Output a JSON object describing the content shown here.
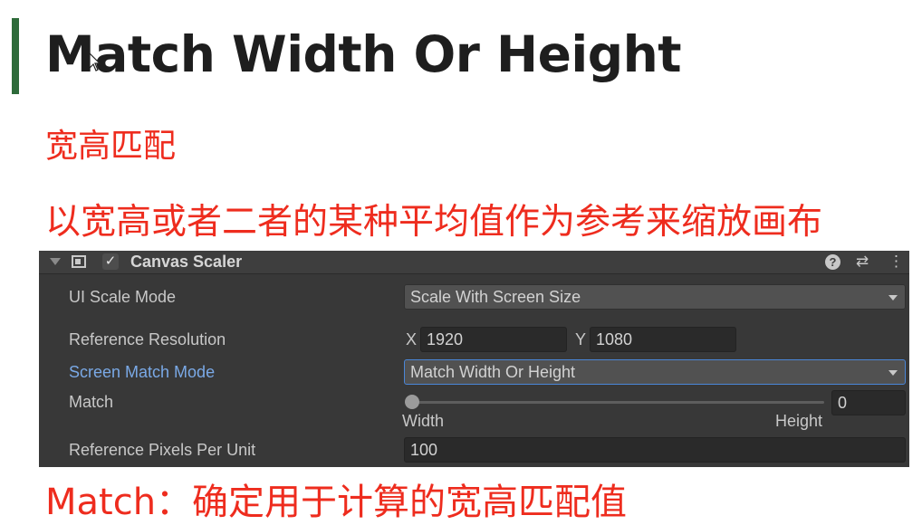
{
  "slide": {
    "title": "Match Width Or Height",
    "subtitle": "宽高匹配",
    "description": "以宽高或者二者的某种平均值作为参考来缩放画布",
    "note": "Match：确定用于计算的宽高匹配值"
  },
  "colors": {
    "accent": "#2e6b3a",
    "highlight_text": "#ee2c1e",
    "active_label": "#7aa9e6"
  },
  "inspector": {
    "component_title": "Canvas Scaler",
    "icons": [
      "foldout-arrow-icon",
      "canvas-scaler-icon",
      "checkmark-icon",
      "help-icon",
      "preset-icon",
      "context-menu-icon"
    ],
    "ui_scale_mode": {
      "label": "UI Scale Mode",
      "value": "Scale With Screen Size"
    },
    "reference_resolution": {
      "label": "Reference Resolution",
      "x_label": "X",
      "x_value": "1920",
      "y_label": "Y",
      "y_value": "1080"
    },
    "screen_match_mode": {
      "label": "Screen Match Mode",
      "value": "Match Width Or Height"
    },
    "match": {
      "label": "Match",
      "value": "0",
      "min_label": "Width",
      "max_label": "Height",
      "slider_fraction": 0
    },
    "reference_pixels_per_unit": {
      "label": "Reference Pixels Per Unit",
      "value": "100"
    }
  }
}
